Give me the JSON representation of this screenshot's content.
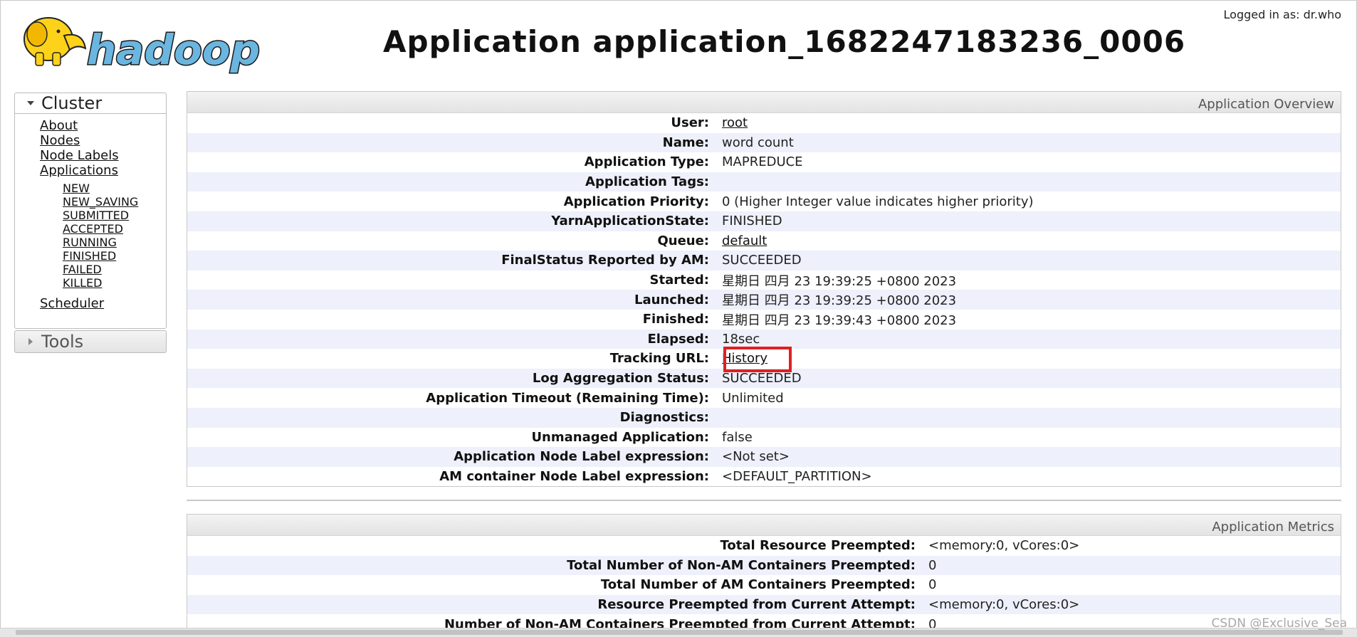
{
  "header": {
    "logo_text": "hadoop",
    "title": "Application application_1682247183236_0006",
    "logged_in": "Logged in as: dr.who"
  },
  "nav": {
    "cluster_label": "Cluster",
    "links": [
      "About",
      "Nodes",
      "Node Labels",
      "Applications"
    ],
    "app_states": [
      "NEW",
      "NEW_SAVING",
      "SUBMITTED",
      "ACCEPTED",
      "RUNNING",
      "FINISHED",
      "FAILED",
      "KILLED"
    ],
    "scheduler": "Scheduler",
    "tools_label": "Tools"
  },
  "overview": {
    "title": "Application Overview",
    "rows": [
      {
        "label": "User:",
        "value": "root",
        "link": true
      },
      {
        "label": "Name:",
        "value": "word count"
      },
      {
        "label": "Application Type:",
        "value": "MAPREDUCE"
      },
      {
        "label": "Application Tags:",
        "value": ""
      },
      {
        "label": "Application Priority:",
        "value": "0 (Higher Integer value indicates higher priority)"
      },
      {
        "label": "YarnApplicationState:",
        "value": "FINISHED"
      },
      {
        "label": "Queue:",
        "value": "default",
        "link": true
      },
      {
        "label": "FinalStatus Reported by AM:",
        "value": "SUCCEEDED"
      },
      {
        "label": "Started:",
        "value": "星期日 四月 23 19:39:25 +0800 2023"
      },
      {
        "label": "Launched:",
        "value": "星期日 四月 23 19:39:25 +0800 2023"
      },
      {
        "label": "Finished:",
        "value": "星期日 四月 23 19:39:43 +0800 2023"
      },
      {
        "label": "Elapsed:",
        "value": "18sec"
      },
      {
        "label": "Tracking URL:",
        "value": "History",
        "link": true
      },
      {
        "label": "Log Aggregation Status:",
        "value": "SUCCEEDED"
      },
      {
        "label": "Application Timeout (Remaining Time):",
        "value": "Unlimited"
      },
      {
        "label": "Diagnostics:",
        "value": ""
      },
      {
        "label": "Unmanaged Application:",
        "value": "false"
      },
      {
        "label": "Application Node Label expression:",
        "value": "<Not set>"
      },
      {
        "label": "AM container Node Label expression:",
        "value": "<DEFAULT_PARTITION>"
      }
    ]
  },
  "metrics": {
    "title": "Application Metrics",
    "rows": [
      {
        "label": "Total Resource Preempted:",
        "value": "<memory:0, vCores:0>"
      },
      {
        "label": "Total Number of Non-AM Containers Preempted:",
        "value": "0"
      },
      {
        "label": "Total Number of AM Containers Preempted:",
        "value": "0"
      },
      {
        "label": "Resource Preempted from Current Attempt:",
        "value": "<memory:0, vCores:0>"
      },
      {
        "label": "Number of Non-AM Containers Preempted from Current Attempt:",
        "value": "0"
      }
    ]
  },
  "watermark": "CSDN @Exclusive_Sea",
  "colors": {
    "highlight": "#e02020",
    "logo_yellow": "#ffd21a",
    "logo_blue": "#6ab6e0"
  }
}
